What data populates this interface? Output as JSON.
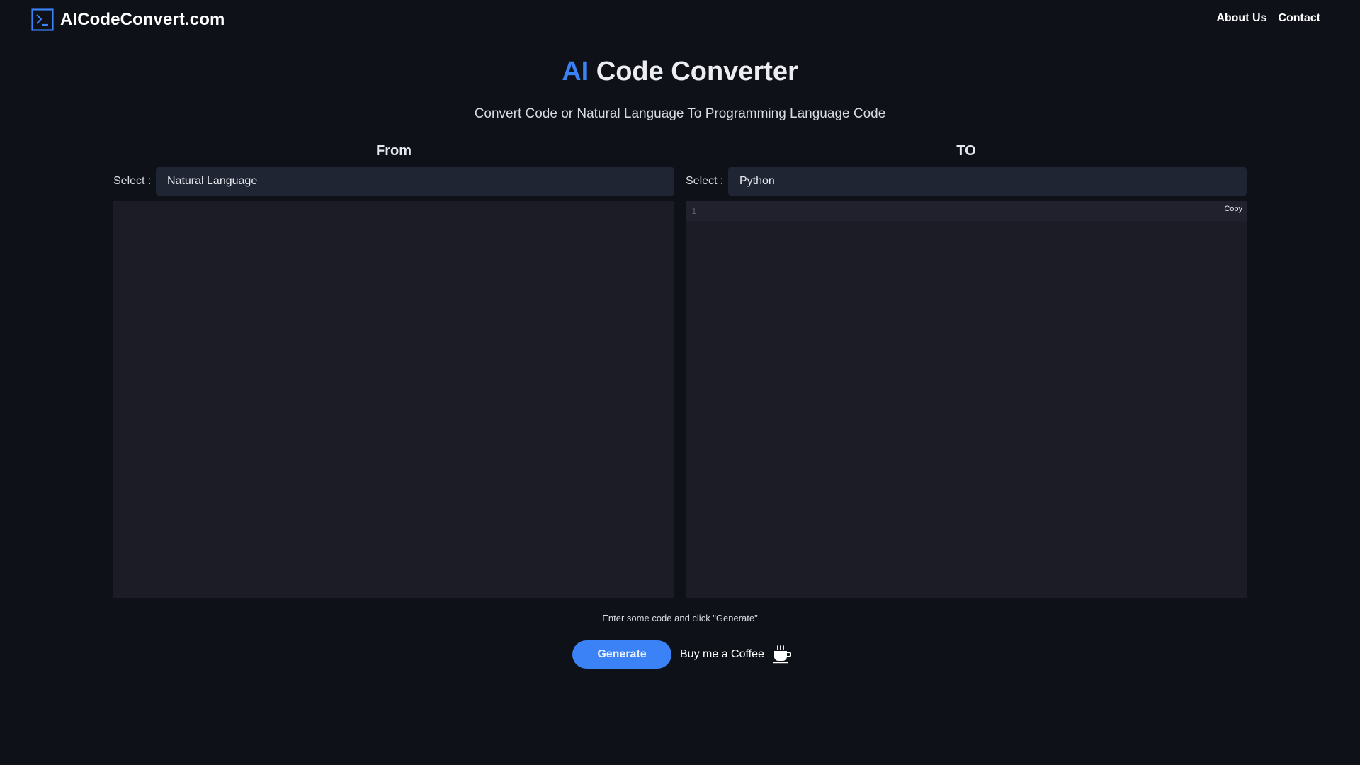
{
  "header": {
    "brand_icon": "terminal-icon",
    "brand_name": "AICodeConvert.com",
    "nav": [
      {
        "label": "About Us"
      },
      {
        "label": "Contact"
      }
    ]
  },
  "hero": {
    "title_accent": "AI",
    "title_rest": "Code Converter",
    "subtitle": "Convert Code or Natural Language To Programming Language Code"
  },
  "from_panel": {
    "heading": "From",
    "select_label": "Select :",
    "selected": "Natural Language",
    "input_value": ""
  },
  "to_panel": {
    "heading": "TO",
    "select_label": "Select :",
    "selected": "Python",
    "line_number": "1",
    "copy_label": "Copy"
  },
  "footer": {
    "hint": "Enter some code and click \"Generate\"",
    "generate_label": "Generate",
    "coffee_label": "Buy me a Coffee",
    "coffee_icon": "coffee-cup-icon"
  },
  "colors": {
    "background": "#0e1117",
    "accent": "#3b82f6",
    "select_bg": "#1f2533",
    "editor_bg": "#1c1c26"
  }
}
